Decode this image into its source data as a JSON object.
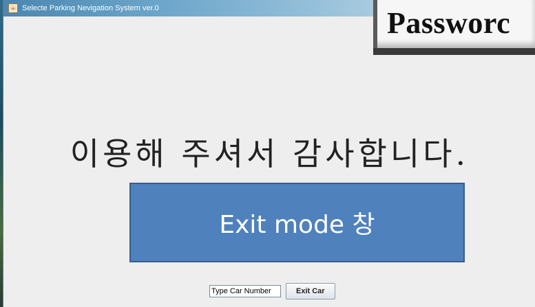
{
  "window": {
    "title": "Selecte Parking Nevigation System ver.0",
    "icon": "java-app-icon"
  },
  "overlay": {
    "text": "Passworc"
  },
  "main": {
    "thanks_message": "이용해 주셔서 감사합니다.",
    "mode_label": "Exit mode 창",
    "mode_box_color": "#4f81bd"
  },
  "controls": {
    "car_number_value": "Type Car Number",
    "exit_button_label": "Exit Car"
  }
}
